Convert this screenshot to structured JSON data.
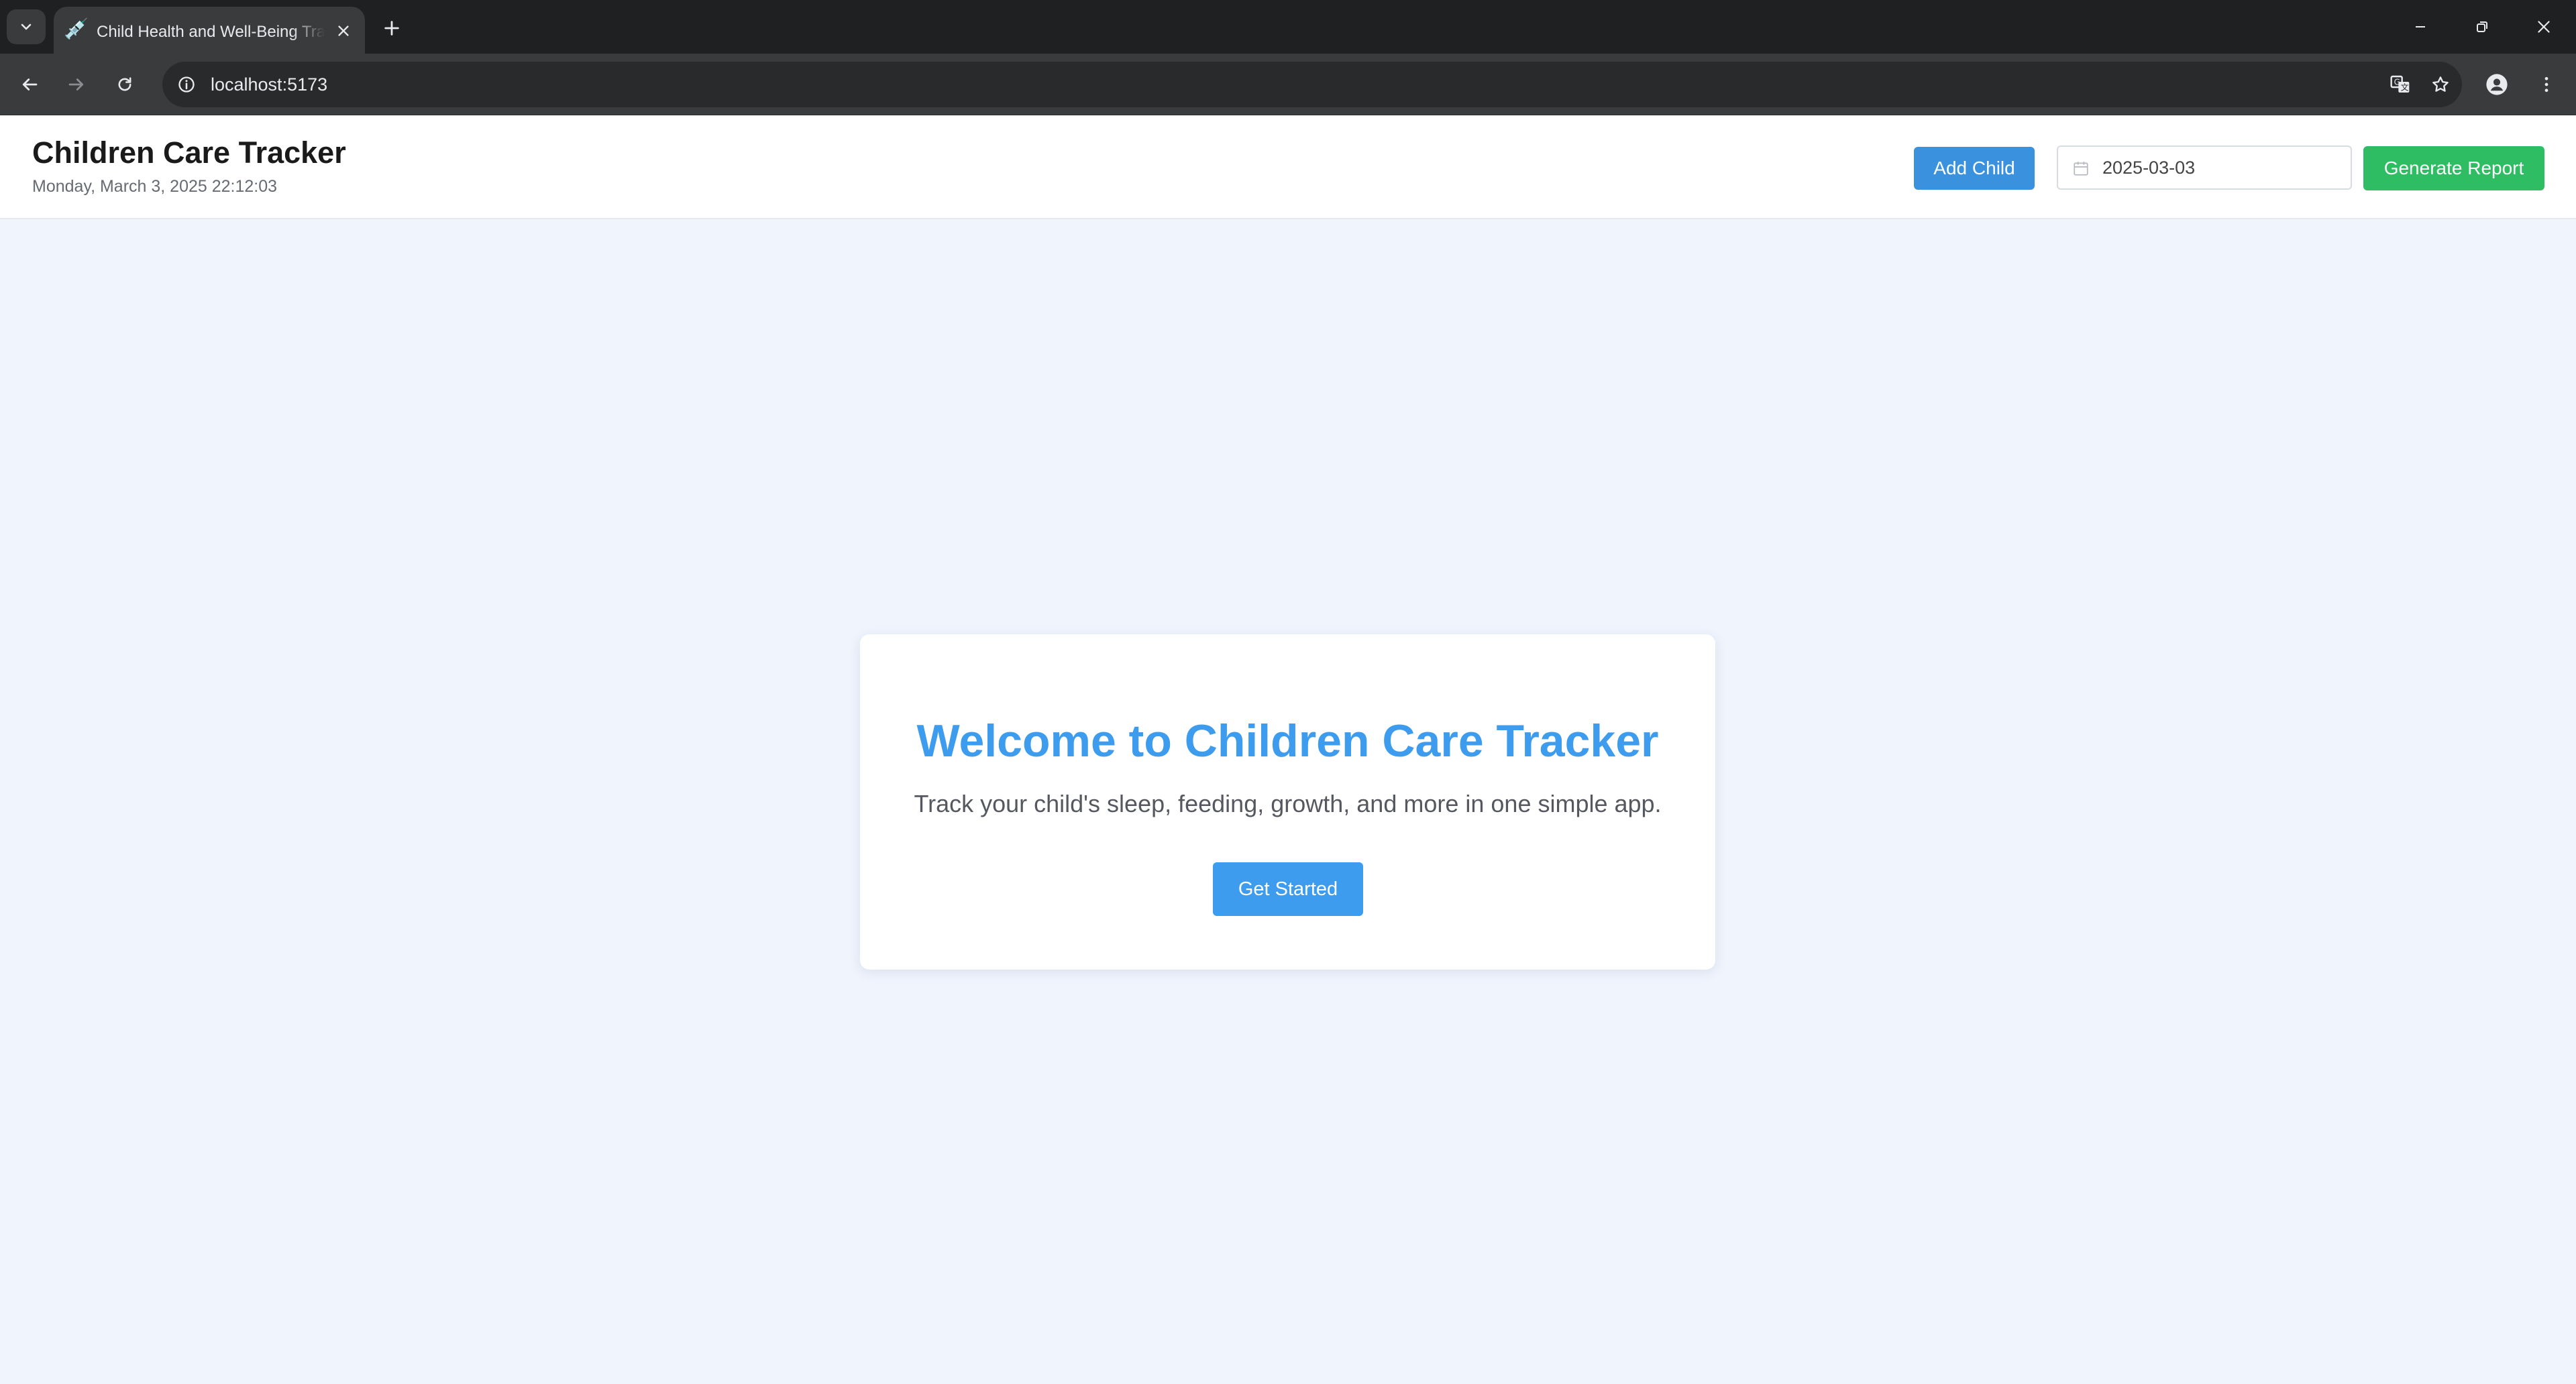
{
  "browser": {
    "tab_title": "Child Health and Well-Being Tracker",
    "tab_favicon": "💉",
    "address": "localhost:5173",
    "icons": {
      "tab_search": "chevron-down-icon",
      "tab_close": "close-icon",
      "new_tab": "plus-icon",
      "back": "arrow-left-icon",
      "forward": "arrow-right-icon",
      "reload": "reload-icon",
      "site_info": "info-icon",
      "translate": "translate-icon",
      "bookmark": "star-icon",
      "profile": "person-icon",
      "menu": "kebab-menu-icon",
      "minimize": "minimize-icon",
      "restore": "restore-icon",
      "close": "close-icon"
    }
  },
  "header": {
    "title": "Children Care Tracker",
    "datetime": "Monday, March 3, 2025 22:12:03",
    "add_child_label": "Add Child",
    "date_value": "2025-03-03",
    "generate_report_label": "Generate Report"
  },
  "welcome": {
    "title": "Welcome to Children Care Tracker",
    "subtitle": "Track your child's sleep, feeding, growth, and more in one simple app.",
    "cta_label": "Get Started"
  },
  "colors": {
    "page_bg": "#eff4fd",
    "primary_blue": "#3d9cee",
    "add_child_blue": "#3a91dd",
    "report_green": "#2ebd62",
    "chrome_dark": "#1f2021",
    "chrome_toolbar": "#3a3b3d"
  }
}
